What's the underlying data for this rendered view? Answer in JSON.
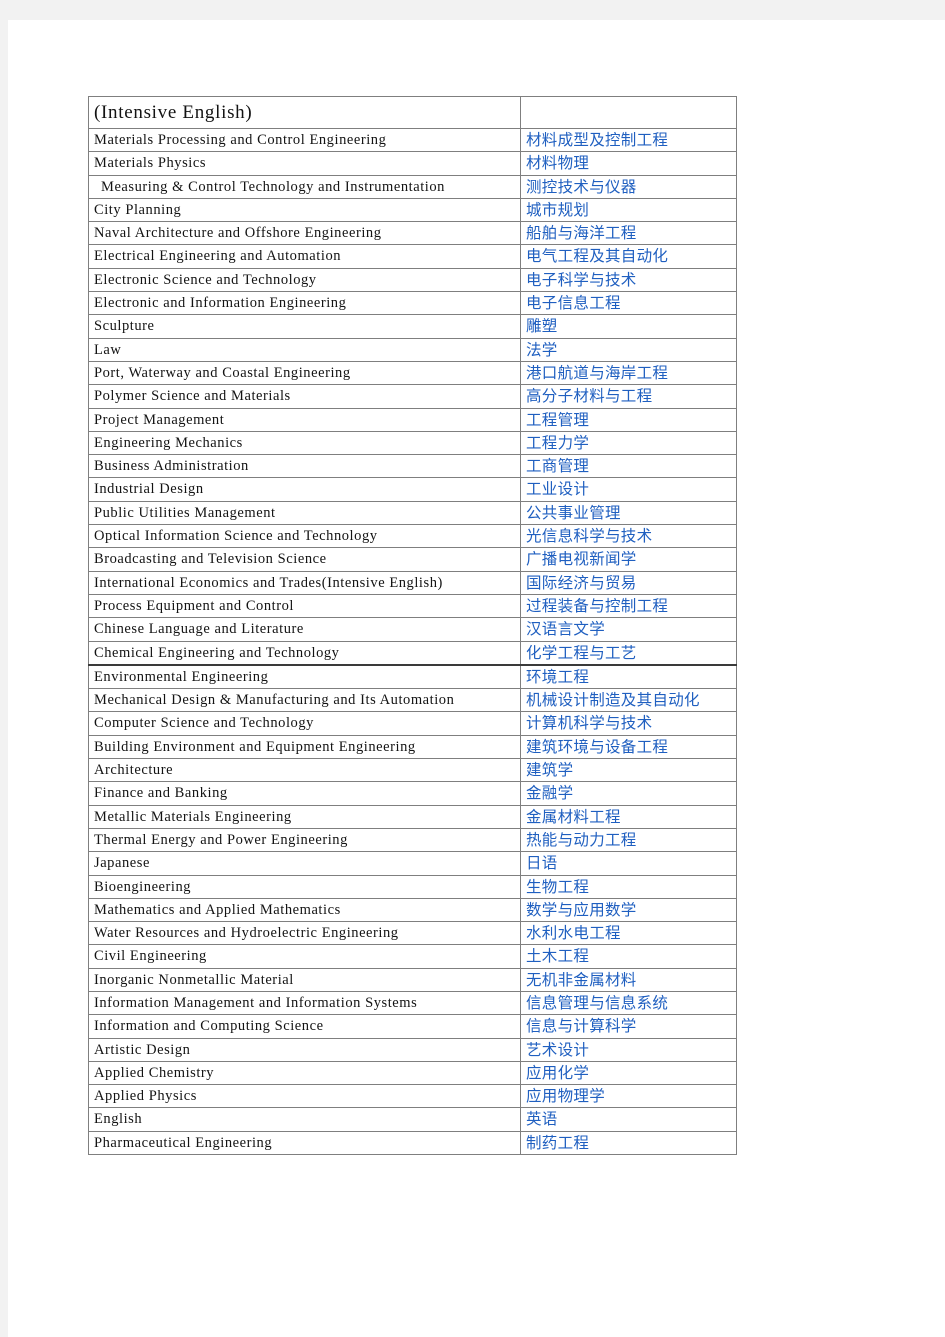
{
  "document": {
    "page_background": "#ffffff",
    "backdrop": "#f2f2f2",
    "english_text_color": "#131313",
    "chinese_text_color": "#1f5fc0",
    "border_color": "#7f7f7f"
  },
  "table": {
    "columns": [
      "english_name",
      "chinese_name"
    ],
    "rows": [
      {
        "en": "(Intensive English)",
        "zh": "",
        "lead": true
      },
      {
        "en": "Materials Processing and Control Engineering",
        "zh": "材料成型及控制工程"
      },
      {
        "en": "Materials Physics",
        "zh": "材料物理"
      },
      {
        "en": " Measuring & Control Technology and Instrumentation",
        "zh": "测控技术与仪器",
        "indent": true
      },
      {
        "en": "City Planning",
        "zh": "城市规划"
      },
      {
        "en": "Naval Architecture and Offshore Engineering",
        "zh": "船舶与海洋工程"
      },
      {
        "en": "Electrical Engineering and Automation",
        "zh": "电气工程及其自动化"
      },
      {
        "en": "Electronic Science and Technology",
        "zh": "电子科学与技术"
      },
      {
        "en": "Electronic and Information Engineering",
        "zh": "电子信息工程"
      },
      {
        "en": "Sculpture",
        "zh": "雕塑"
      },
      {
        "en": "Law",
        "zh": "法学"
      },
      {
        "en": "Port, Waterway and Coastal Engineering",
        "zh": "港口航道与海岸工程"
      },
      {
        "en": "Polymer Science and Materials",
        "zh": "高分子材料与工程"
      },
      {
        "en": "Project Management",
        "zh": "工程管理"
      },
      {
        "en": "Engineering Mechanics",
        "zh": "工程力学"
      },
      {
        "en": "Business Administration",
        "zh": "工商管理"
      },
      {
        "en": "Industrial Design",
        "zh": "工业设计"
      },
      {
        "en": "Public Utilities Management",
        "zh": "公共事业管理"
      },
      {
        "en": "Optical Information Science and Technology",
        "zh": "光信息科学与技术"
      },
      {
        "en": "Broadcasting and Television Science",
        "zh": "广播电视新闻学"
      },
      {
        "en": "International Economics and Trades(Intensive English)",
        "zh": "国际经济与贸易"
      },
      {
        "en": "Process Equipment and Control",
        "zh": "过程装备与控制工程"
      },
      {
        "en": "Chinese Language and Literature",
        "zh": "汉语言文学"
      },
      {
        "en": "Chemical Engineering and Technology",
        "zh": "化学工程与工艺"
      },
      {
        "en": "Environmental Engineering",
        "zh": "环境工程",
        "rule_above": true
      },
      {
        "en": "Mechanical Design & Manufacturing and Its Automation",
        "zh": "机械设计制造及其自动化"
      },
      {
        "en": "Computer Science and Technology",
        "zh": "计算机科学与技术"
      },
      {
        "en": "Building Environment and Equipment Engineering",
        "zh": "建筑环境与设备工程"
      },
      {
        "en": "Architecture",
        "zh": "建筑学"
      },
      {
        "en": "Finance and Banking",
        "zh": "金融学"
      },
      {
        "en": "Metallic Materials Engineering",
        "zh": "金属材料工程"
      },
      {
        "en": "Thermal Energy and Power Engineering",
        "zh": "热能与动力工程"
      },
      {
        "en": "Japanese",
        "zh": "日语"
      },
      {
        "en": "Bioengineering",
        "zh": "生物工程"
      },
      {
        "en": "Mathematics and Applied Mathematics",
        "zh": "数学与应用数学"
      },
      {
        "en": "Water Resources and Hydroelectric Engineering",
        "zh": "水利水电工程"
      },
      {
        "en": "Civil Engineering",
        "zh": "土木工程"
      },
      {
        "en": "Inorganic Nonmetallic Material",
        "zh": "无机非金属材料"
      },
      {
        "en": "Information Management and Information Systems",
        "zh": "信息管理与信息系统"
      },
      {
        "en": "Information and Computing Science",
        "zh": "信息与计算科学"
      },
      {
        "en": "Artistic Design",
        "zh": "艺术设计"
      },
      {
        "en": "Applied Chemistry",
        "zh": "应用化学"
      },
      {
        "en": "Applied Physics",
        "zh": "应用物理学"
      },
      {
        "en": "English",
        "zh": "英语"
      },
      {
        "en": "Pharmaceutical Engineering",
        "zh": "制药工程"
      }
    ]
  }
}
